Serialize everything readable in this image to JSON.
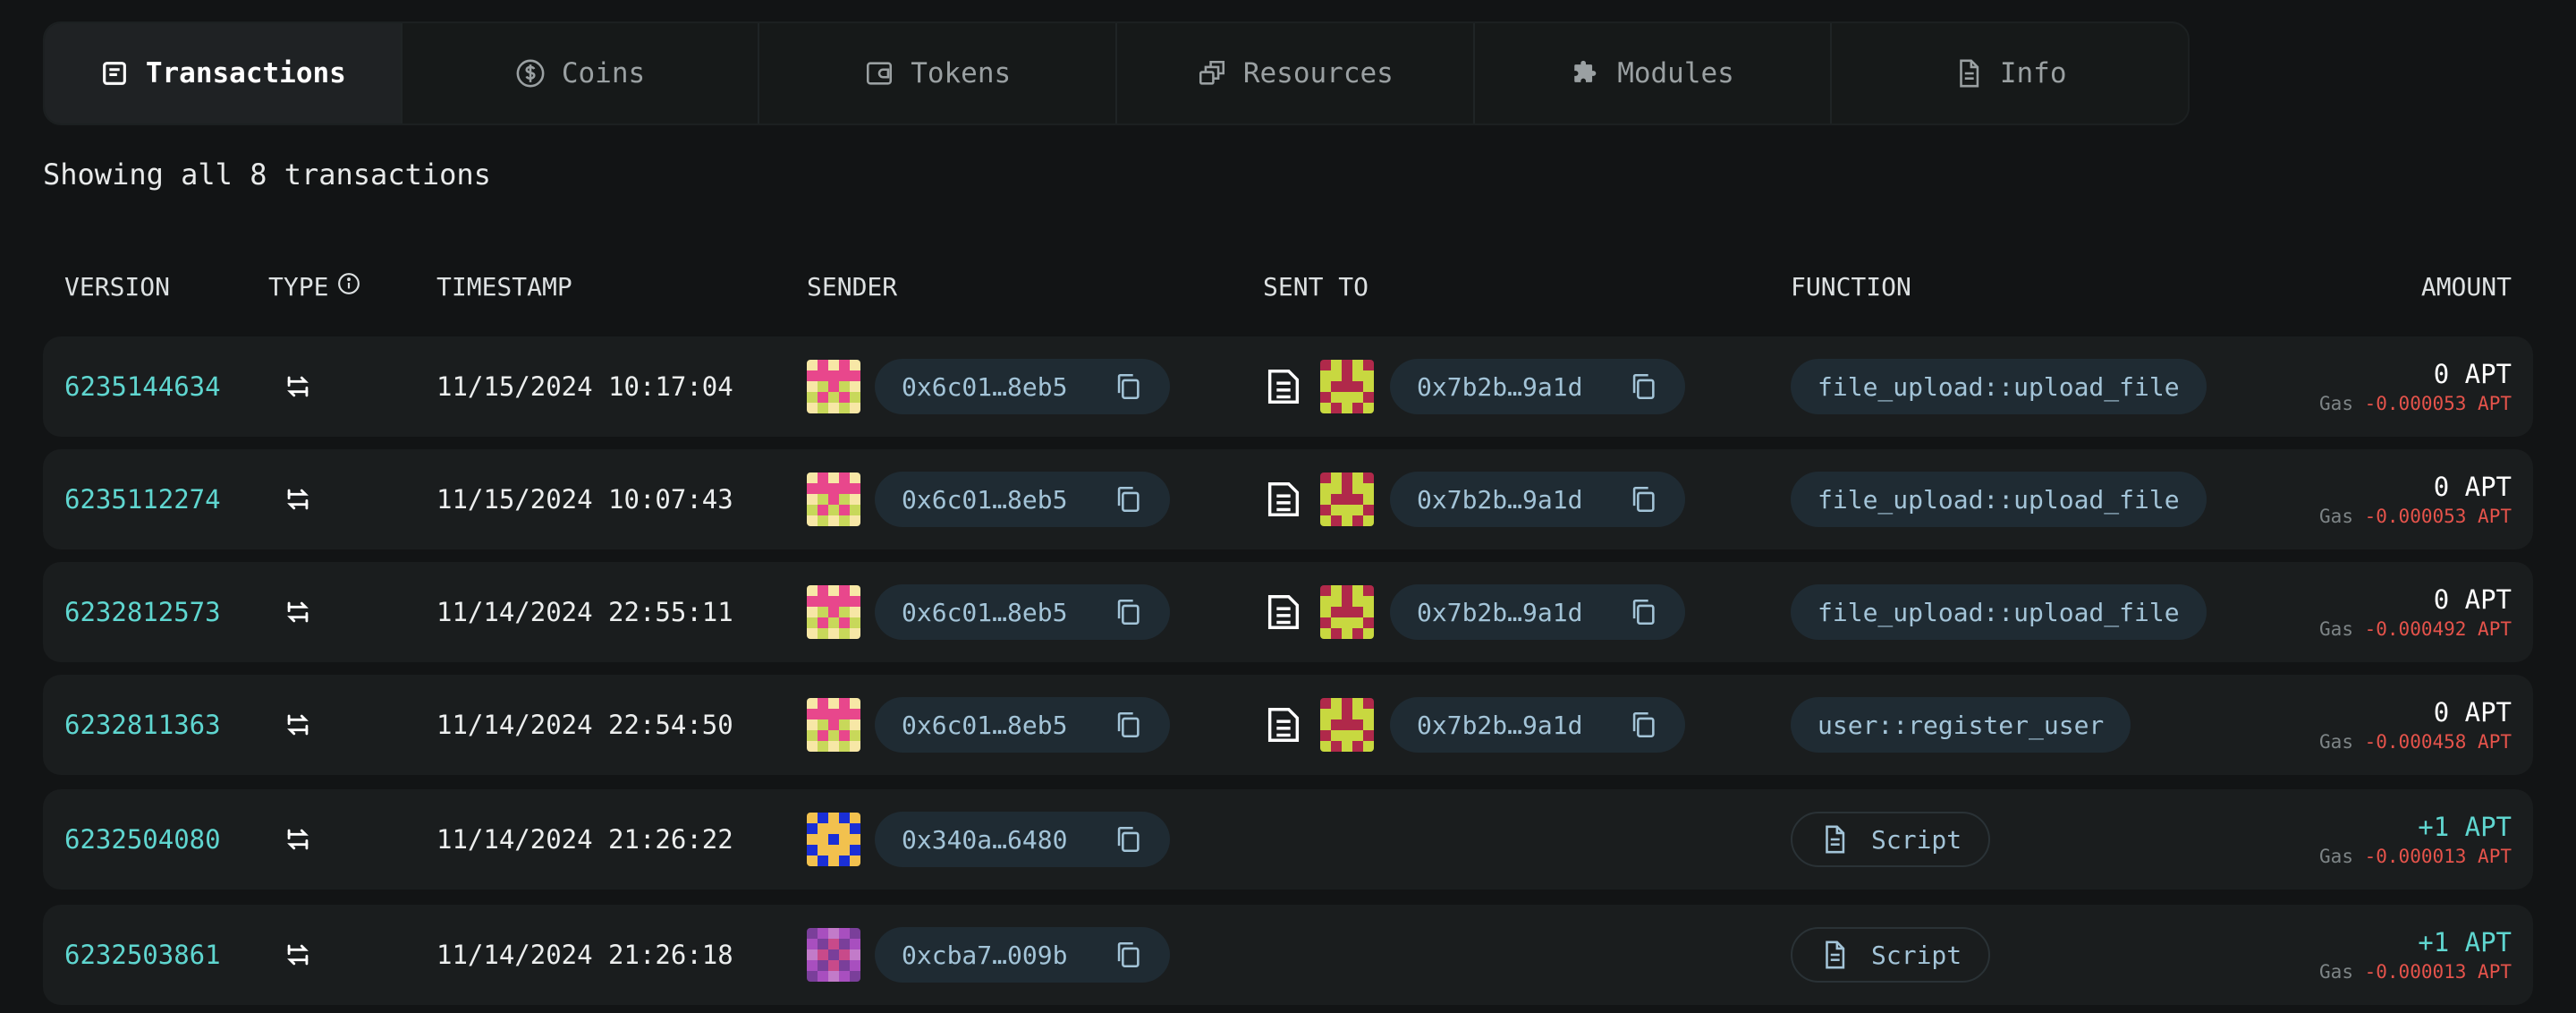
{
  "tabs": [
    {
      "label": "Transactions",
      "icon": "transactions-icon",
      "active": true
    },
    {
      "label": "Coins",
      "icon": "coins-icon",
      "active": false
    },
    {
      "label": "Tokens",
      "icon": "tokens-icon",
      "active": false
    },
    {
      "label": "Resources",
      "icon": "resources-icon",
      "active": false
    },
    {
      "label": "Modules",
      "icon": "modules-icon",
      "active": false
    },
    {
      "label": "Info",
      "icon": "info-doc-icon",
      "active": false
    }
  ],
  "summary": "Showing all 8 transactions",
  "headers": {
    "version": "VERSION",
    "type": "TYPE",
    "timestamp": "TIMESTAMP",
    "sender": "SENDER",
    "sent_to": "SENT TO",
    "function": "FUNCTION",
    "amount": "AMOUNT"
  },
  "colors": {
    "accent": "#5fd6d0",
    "negative": "#e5534b",
    "pill": "#1f2b33"
  },
  "rows": [
    {
      "version": "6235144634",
      "timestamp": "11/15/2024 10:17:04",
      "sender": "0x6c01…8eb5",
      "sender_avatar": "pink",
      "sent_to": "0x7b2b…9a1d",
      "sent_to_avatar": "olive",
      "function": "file_upload::upload_file",
      "function_kind": "fn",
      "amount": "0 APT",
      "amount_positive": false,
      "gas_label": "Gas",
      "gas": "-0.000053 APT"
    },
    {
      "version": "6235112274",
      "timestamp": "11/15/2024 10:07:43",
      "sender": "0x6c01…8eb5",
      "sender_avatar": "pink",
      "sent_to": "0x7b2b…9a1d",
      "sent_to_avatar": "olive",
      "function": "file_upload::upload_file",
      "function_kind": "fn",
      "amount": "0 APT",
      "amount_positive": false,
      "gas_label": "Gas",
      "gas": "-0.000053 APT"
    },
    {
      "version": "6232812573",
      "timestamp": "11/14/2024 22:55:11",
      "sender": "0x6c01…8eb5",
      "sender_avatar": "pink",
      "sent_to": "0x7b2b…9a1d",
      "sent_to_avatar": "olive",
      "function": "file_upload::upload_file",
      "function_kind": "fn",
      "amount": "0 APT",
      "amount_positive": false,
      "gas_label": "Gas",
      "gas": "-0.000492 APT"
    },
    {
      "version": "6232811363",
      "timestamp": "11/14/2024 22:54:50",
      "sender": "0x6c01…8eb5",
      "sender_avatar": "pink",
      "sent_to": "0x7b2b…9a1d",
      "sent_to_avatar": "olive",
      "function": "user::register_user",
      "function_kind": "fn",
      "amount": "0 APT",
      "amount_positive": false,
      "gas_label": "Gas",
      "gas": "-0.000458 APT"
    },
    {
      "version": "6232504080",
      "timestamp": "11/14/2024 21:26:22",
      "sender": "0x340a…6480",
      "sender_avatar": "blue",
      "sent_to": "",
      "sent_to_avatar": "",
      "function": "Script",
      "function_kind": "script",
      "amount": "+1 APT",
      "amount_positive": true,
      "gas_label": "Gas",
      "gas": "-0.000013 APT"
    },
    {
      "version": "6232503861",
      "timestamp": "11/14/2024 21:26:18",
      "sender": "0xcba7…009b",
      "sender_avatar": "purple",
      "sent_to": "",
      "sent_to_avatar": "",
      "function": "Script",
      "function_kind": "script",
      "amount": "+1 APT",
      "amount_positive": true,
      "gas_label": "Gas",
      "gas": "-0.000013 APT"
    }
  ]
}
